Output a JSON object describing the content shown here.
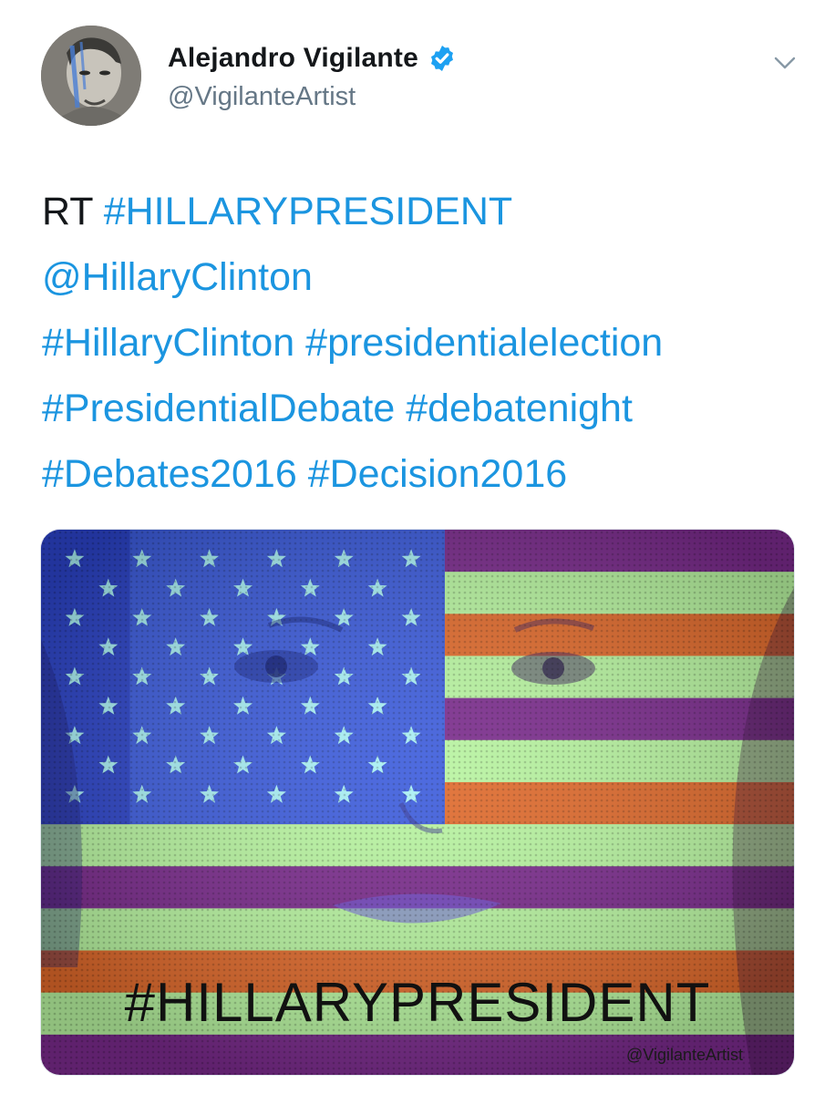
{
  "tweet": {
    "author": {
      "display_name": "Alejandro Vigilante",
      "handle": "@VigilanteArtist",
      "verified": true,
      "verified_icon": "verified-badge-icon",
      "verified_color": "#1da1f2"
    },
    "menu_icon": "chevron-down-icon",
    "text_lines": [
      [
        {
          "text": "RT ",
          "type": "plain"
        },
        {
          "text": "#HILLARYPRESIDENT",
          "type": "hashtag"
        }
      ],
      [
        {
          "text": "@HillaryClinton",
          "type": "mention"
        }
      ],
      [
        {
          "text": "#HillaryClinton",
          "type": "hashtag"
        },
        {
          "text": " ",
          "type": "plain"
        },
        {
          "text": "#presidentialelection",
          "type": "hashtag"
        }
      ],
      [
        {
          "text": "#PresidentialDebate",
          "type": "hashtag"
        },
        {
          "text": " ",
          "type": "plain"
        },
        {
          "text": "#debatenight",
          "type": "hashtag"
        }
      ],
      [
        {
          "text": "#Debates2016",
          "type": "hashtag"
        },
        {
          "text": " ",
          "type": "plain"
        },
        {
          "text": "#Decision2016",
          "type": "hashtag"
        }
      ]
    ],
    "link_color": "#1b95e0",
    "media": {
      "caption": "#HILLARYPRESIDENT",
      "watermark": "@VigilanteArtist",
      "colors": {
        "canton": "#3b5bdc",
        "star": "#a8f0f5",
        "stripe_light": "#b8f5a0",
        "stripe_dark_a": "#e0692a",
        "stripe_dark_b": "#7a2a8c"
      }
    }
  }
}
